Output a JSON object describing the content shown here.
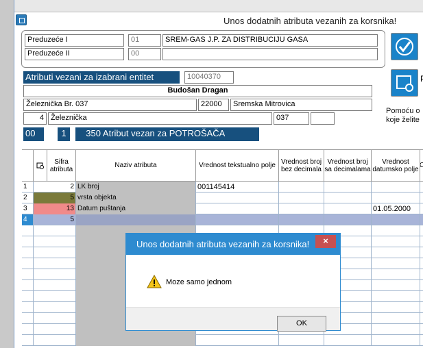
{
  "window": {
    "title": "Unos dodatnih atributa vezanih za korsnika!"
  },
  "company": {
    "row1": {
      "label": "Preduzeće I",
      "code": "01",
      "name": "SREM-GAS J.P. ZA DISTRIBUCIJU GASA"
    },
    "row2": {
      "label": "Preduzeće II",
      "code": "00",
      "name": ""
    }
  },
  "entity": {
    "header_label": "Atributi vezani za izabrani entitet",
    "entity_id": "10040370",
    "person_name": "Budošan Dragan",
    "street": "Železnička Br. 037",
    "postal": "22000",
    "city": "Sremska Mitrovica",
    "street_no": "4",
    "street_name": "Železnička",
    "house_no": "037",
    "extra": "",
    "attr_code1": "00",
    "attr_code2": "1",
    "attr_code3": "350",
    "attr_title": "Atribut vezan za POTROŠAČA"
  },
  "side": {
    "help_text_1": "Pomoću o",
    "help_text_2": "koje želite",
    "btn2_label": "P"
  },
  "grid": {
    "headers": {
      "sifra": "Sifra atributa",
      "naziv": "Naziv atributa",
      "tekst": "Vrednost tekstualno polje",
      "broj_bez": "Vrednost broj bez decimala",
      "broj_sa": "Vrednost broj sa decimalama",
      "datum": "Vrednost datumsko polje",
      "last": "C"
    },
    "rows": [
      {
        "n": "1",
        "sifra": "2",
        "naziv": "LK broj",
        "tekst": "001145414",
        "datum": ""
      },
      {
        "n": "2",
        "sifra": "5",
        "naziv": "vrsta objekta",
        "tekst": "",
        "datum": ""
      },
      {
        "n": "3",
        "sifra": "13",
        "naziv": "Datum puštanja",
        "tekst": "",
        "datum": "01.05.2000"
      },
      {
        "n": "4",
        "sifra": "5",
        "naziv": "",
        "tekst": "",
        "datum": ""
      }
    ]
  },
  "dialog": {
    "title": "Unos dodatnih atributa vezanih za korsnika!",
    "message": "Moze samo jednom",
    "ok_label": "OK",
    "close_symbol": "×"
  },
  "colors": {
    "accent": "#17507e",
    "dialog": "#2e8bd0",
    "row2": "#7a7a3a",
    "row3": "#f08a8a",
    "selected": "#a8b4d8"
  }
}
